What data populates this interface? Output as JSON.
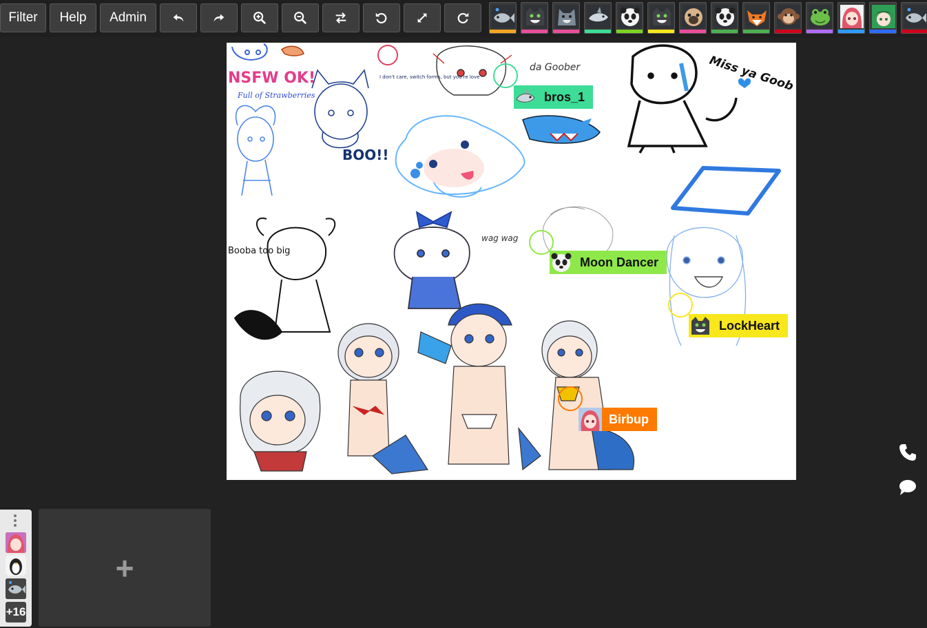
{
  "toolbar": {
    "filter_label": "Filter",
    "help_label": "Help",
    "admin_label": "Admin",
    "icons": [
      "undo-icon",
      "redo-icon",
      "zoom-in-icon",
      "zoom-out-icon",
      "swap-icon",
      "rotate-left-icon",
      "fullscreen-icon",
      "rotate-right-icon"
    ]
  },
  "users": [
    {
      "avatar": "fish-icon",
      "color": "#f5a623"
    },
    {
      "avatar": "cat-icon",
      "color": "#e94e9b"
    },
    {
      "avatar": "wolf-icon",
      "color": "#e94e9b"
    },
    {
      "avatar": "shark-icon",
      "color": "#3ddc97"
    },
    {
      "avatar": "panda-icon",
      "color": "#7ed321"
    },
    {
      "avatar": "cat-icon",
      "color": "#f8e71c"
    },
    {
      "avatar": "pug-icon",
      "color": "#e94e9b"
    },
    {
      "avatar": "panda-icon",
      "color": "#4caf50"
    },
    {
      "avatar": "fox-icon",
      "color": "#4caf50"
    },
    {
      "avatar": "monkey-icon",
      "color": "#d0021b"
    },
    {
      "avatar": "frog-icon",
      "color": "#b26bff"
    },
    {
      "avatar": "anime-girl-icon",
      "color": "#2e9bff"
    },
    {
      "avatar": "anime-boy-icon",
      "color": "#2e6bff"
    },
    {
      "avatar": "fish-icon",
      "color": "#d0021b"
    }
  ],
  "cursors": [
    {
      "name": "bros_1",
      "avatar": "shark-icon",
      "color": "#3ddc97"
    },
    {
      "name": "Moon Dancer",
      "avatar": "panda-icon",
      "color": "#8fe84a"
    },
    {
      "name": "LockHeart",
      "avatar": "cat-icon",
      "color": "#f8e71c"
    },
    {
      "name": "Birbup",
      "avatar": "anime-girl-icon",
      "color": "#ff7a00"
    }
  ],
  "canvas_text": {
    "sfw": "NSFW OK!",
    "straw": "Full of Strawberries",
    "boo": "BOO!!",
    "goober": "da Goober",
    "missya": "Miss ya Goob",
    "booba": "Booba too big",
    "wag": "wag wag",
    "note": "I don't care, switch forms, but you're love"
  },
  "sidebar": {
    "more_users": "+16",
    "list_avatars": [
      "anime-girl-icon",
      "penguin-icon",
      "fish-icon"
    ],
    "add_label": "+"
  },
  "side_icons": [
    "phone-icon",
    "chat-icon"
  ]
}
